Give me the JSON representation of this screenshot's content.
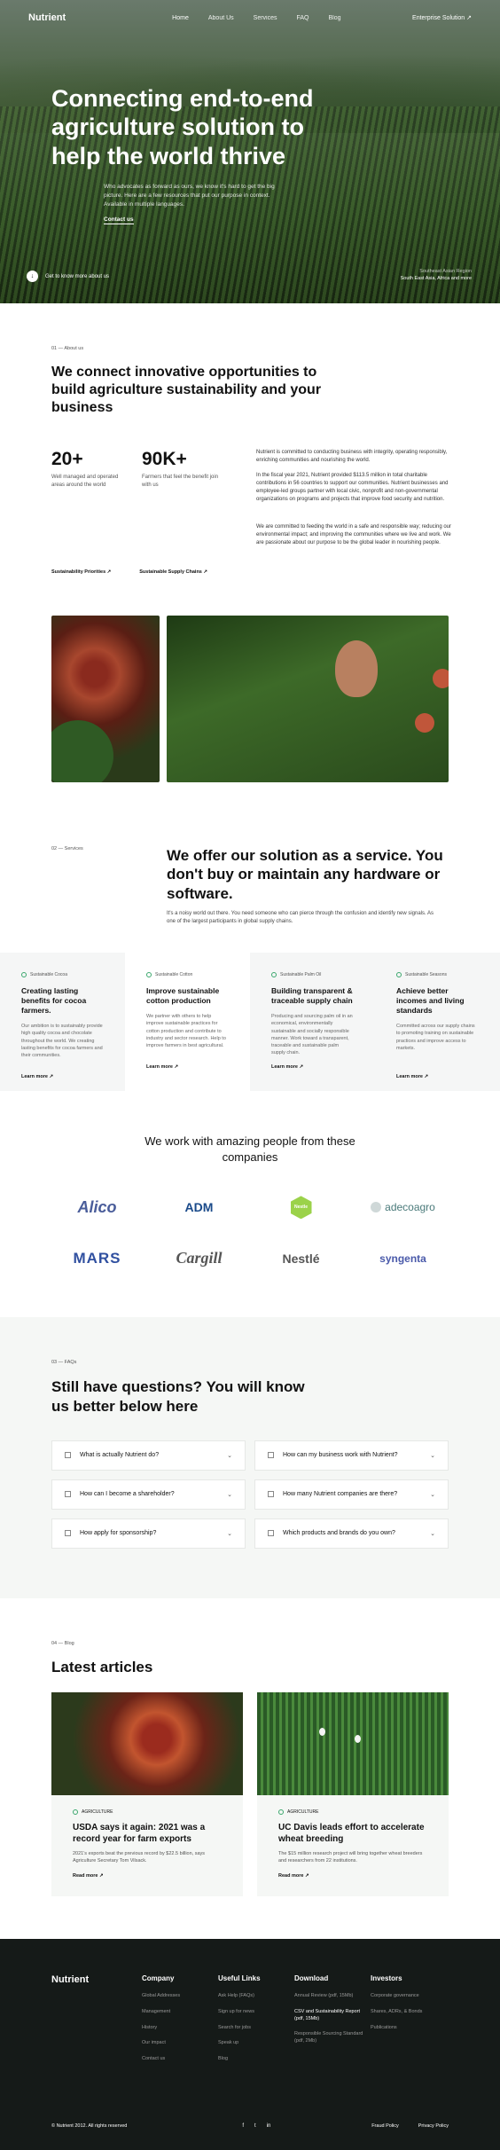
{
  "brand": "Nutrient",
  "nav": {
    "links": [
      "Home",
      "About Us",
      "Services",
      "FAQ",
      "Blog"
    ],
    "cta": "Enterprise Solution ↗"
  },
  "hero": {
    "title": "Connecting end-to-end agriculture solution to help the world thrive",
    "lead": "Who advocates as forward as ours, we know it's hard to get the big picture. Here are a few resources that put our purpose in context. Available in multiple languages.",
    "link": "Contact us",
    "know_more": "Get to know more about us",
    "location_small": "Southeast Asian Region",
    "location": "South East Asia, Africa and more"
  },
  "about": {
    "eyebrow": "01 — About us",
    "title": "We connect innovative opportunities to build agriculture sustainability and your business",
    "stats": [
      {
        "num": "20+",
        "label": "Well managed and operated areas around the world"
      },
      {
        "num": "90K+",
        "label": "Farmers that feel the benefit join with us"
      }
    ],
    "paragraphs": [
      "Nutrient is committed to conducting business with integrity, operating responsibly, enriching communities and nourishing the world.",
      "In the fiscal year 2021, Nutrient provided $113.5 million in total charitable contributions in 56 countries to support our communities. Nutrient businesses and employee-led groups partner with local civic, nonprofit and non-governmental organizations on programs and projects that improve food security and nutrition.",
      "We are committed to feeding the world in a safe and responsible way; reducing our environmental impact; and improving the communities where we live and work. We are passionate about our purpose to be the global leader in nourishing people."
    ],
    "links": [
      "Sustainability Priorities ↗",
      "Sustainable Supply Chains ↗"
    ]
  },
  "services": {
    "eyebrow": "02 — Services",
    "title": "We offer our solution as a service. You don't buy or maintain any hardware or software.",
    "sub": "It's a noisy world out there. You need someone who can pierce through the confusion and identify new signals. As one of the largest participants in global supply chains.",
    "cards": [
      {
        "tag": "Sustainable Cocoa",
        "title": "Creating lasting benefits for cocoa farmers.",
        "text": "Our ambition is to sustainably provide high quality cocoa and chocolate throughout the world. We creating lasting benefits for cocoa farmers and their communities.",
        "more": "Learn more ↗"
      },
      {
        "tag": "Sustainable Cotton",
        "title": "Improve sustainable cotton production",
        "text": "We partner with others to help improve sustainable practices for cotton production and contribute to industry and sector research. Help to improve farmers in best agricultural.",
        "more": "Learn more ↗"
      },
      {
        "tag": "Sustainable Palm Oil",
        "title": "Building transparent & traceable supply chain",
        "text": "Producing and sourcing palm oil in an economical, environmentally sustainable and socially responsible manner. Work toward a transparent, traceable and sustainable palm supply chain.",
        "more": "Learn more ↗"
      },
      {
        "tag": "Sustainable Seasons",
        "title": "Achieve better incomes and living standards",
        "text": "Committed across our supply chains to promoting training on sustainable practices and improve access to markets.",
        "more": "Learn more ↗"
      }
    ]
  },
  "partners": {
    "title": "We work with amazing people from these companies",
    "logos": [
      "Alico",
      "ADM",
      "Nestle",
      "adecoagro",
      "MARS",
      "Cargill",
      "Nestlé",
      "syngenta"
    ]
  },
  "faq": {
    "eyebrow": "03 — FAQs",
    "title": "Still have questions? You will know us better below here",
    "items": [
      "What is actually Nutrient do?",
      "How can my business work with Nutrient?",
      "How can I become a shareholder?",
      "How many Nutrient companies are there?",
      "How apply for sponsorship?",
      "Which products and brands do you own?"
    ]
  },
  "blog": {
    "eyebrow": "04 — Blog",
    "title": "Latest articles",
    "posts": [
      {
        "tag": "AGRICULTURE",
        "title": "USDA says it again: 2021 was a record year for farm exports",
        "text": "2021's exports beat the previous record by $22.5 billion, says Agriculture Secretary Tom Vilsack.",
        "more": "Read more ↗"
      },
      {
        "tag": "AGRICULTURE",
        "title": "UC Davis leads effort to accelerate wheat breeding",
        "text": "The $15 million research project will bring together wheat breeders and researchers from 22 institutions.",
        "more": "Read more ↗"
      }
    ]
  },
  "footer": {
    "columns": [
      {
        "heading": "Company",
        "links": [
          "Global Addresses",
          "Management",
          "History",
          "Our impact",
          "Contact us"
        ]
      },
      {
        "heading": "Useful Links",
        "links": [
          "Ask Help (FAQs)",
          "Sign up for news",
          "Search for jobs",
          "Speak up",
          "Blog"
        ]
      },
      {
        "heading": "Download",
        "links": [
          "Annual Review (pdf, 15Mb)",
          "CSV and Sustainability Report (pdf, 15Mb)",
          "Responsible Sourcing Standard (pdf, 2Mb)"
        ]
      },
      {
        "heading": "Investors",
        "links": [
          "Corporate governance",
          "Shares, ADRs, & Bonds",
          "Publications"
        ]
      }
    ],
    "copyright": "© Nutrient 2012. All rights reserved",
    "socials": [
      "facebook-icon",
      "twitter-icon",
      "linkedin-icon"
    ],
    "legal": [
      "Fraud Policy",
      "Privacy Policy"
    ]
  }
}
